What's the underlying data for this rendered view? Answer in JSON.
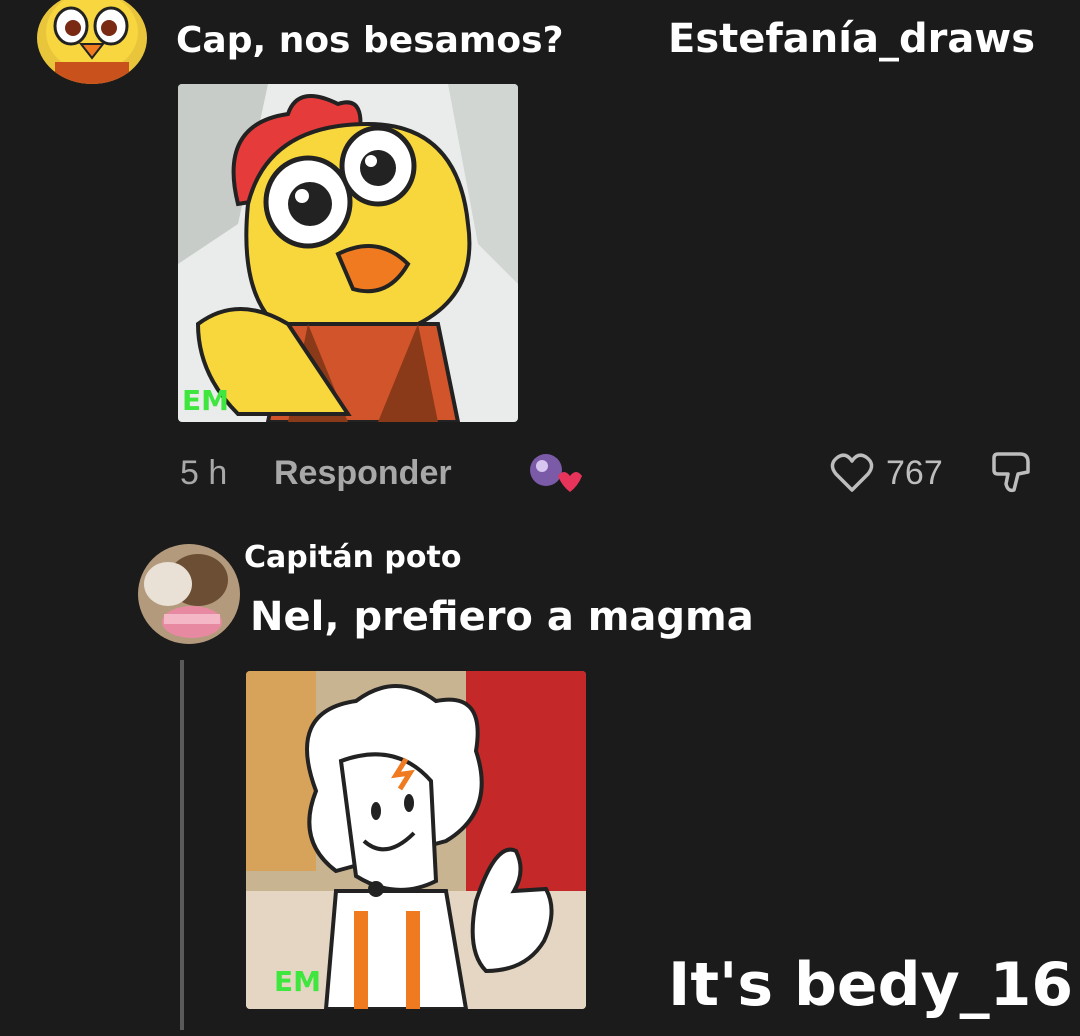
{
  "comment": {
    "text": "Cap, nos besamos?",
    "time": "5 h",
    "reply_label": "Responder",
    "likes": "767"
  },
  "header_credit": "Estefanía_draws",
  "reply": {
    "author": "Capitán poto",
    "text": "Nel, prefiero a magma"
  },
  "footer_credit": "It's bedy_16",
  "image_signatures": [
    "EM",
    "EM"
  ],
  "icons": [
    "heart-icon",
    "dislike-icon",
    "sticker-icon"
  ],
  "colors": {
    "background": "#1b1b1b",
    "text": "#ffffff",
    "meta": "#a8a8a8",
    "signature_green": "#3ee63e"
  }
}
